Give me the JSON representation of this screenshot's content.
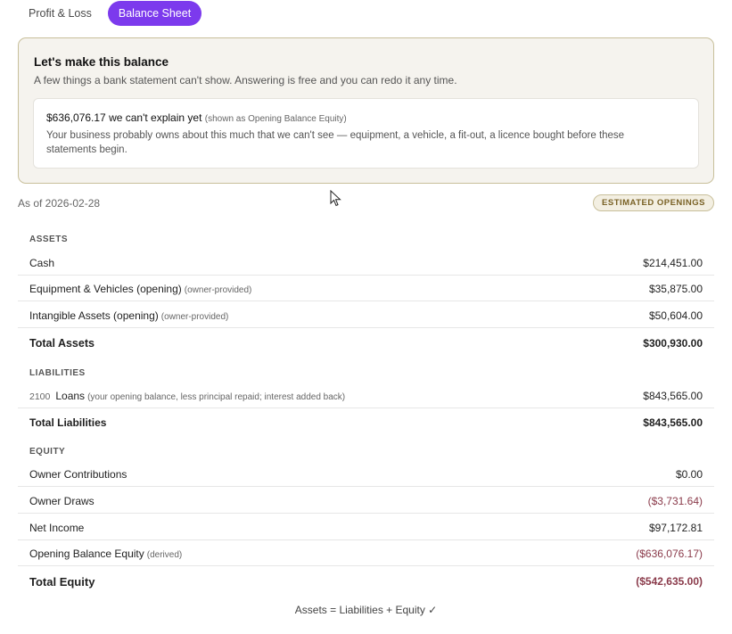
{
  "tabs": [
    {
      "label": "Profit & Loss",
      "active": false
    },
    {
      "label": "Balance Sheet",
      "active": true
    }
  ],
  "banner": {
    "title": "Let's make this balance",
    "subtitle": "A few things a bank statement can't show. Answering is free and you can redo it any time.",
    "card": {
      "headline": "$636,076.17 we can't explain yet",
      "headline_note": "(shown as Opening Balance Equity)",
      "body": "Your business probably owns about this much that we can't see — equipment, a vehicle, a fit-out, a licence bought before these statements begin."
    }
  },
  "as_of": "As of 2026-02-28",
  "badge": "ESTIMATED OPENINGS",
  "assets": {
    "label": "ASSETS",
    "rows": [
      {
        "label": "Cash",
        "note": "",
        "amount": "$214,451.00"
      },
      {
        "label": "Equipment & Vehicles (opening)",
        "note": "(owner-provided)",
        "amount": "$35,875.00"
      },
      {
        "label": "Intangible Assets (opening)",
        "note": "(owner-provided)",
        "amount": "$50,604.00"
      }
    ],
    "total_label": "Total Assets",
    "total_amount": "$300,930.00"
  },
  "liabilities": {
    "label": "LIABILITIES",
    "rows": [
      {
        "code": "2100",
        "label": "Loans",
        "note": "(your opening balance, less principal repaid; interest added back)",
        "amount": "$843,565.00"
      }
    ],
    "total_label": "Total Liabilities",
    "total_amount": "$843,565.00"
  },
  "equity": {
    "label": "EQUITY",
    "rows": [
      {
        "label": "Owner Contributions",
        "note": "",
        "amount": "$0.00"
      },
      {
        "label": "Owner Draws",
        "note": "",
        "amount": "($3,731.64)"
      },
      {
        "label": "Net Income",
        "note": "",
        "amount": "$97,172.81"
      },
      {
        "label": "Opening Balance Equity",
        "note": "(derived)",
        "amount": "($636,076.17)"
      }
    ],
    "total_label": "Total Equity",
    "total_amount": "($542,635.00)"
  },
  "footer": "Assets = Liabilities + Equity ✓",
  "colors": {
    "accent": "#7c3aed",
    "negative": "#8a3a4a",
    "banner_border": "#c8bf9a"
  }
}
